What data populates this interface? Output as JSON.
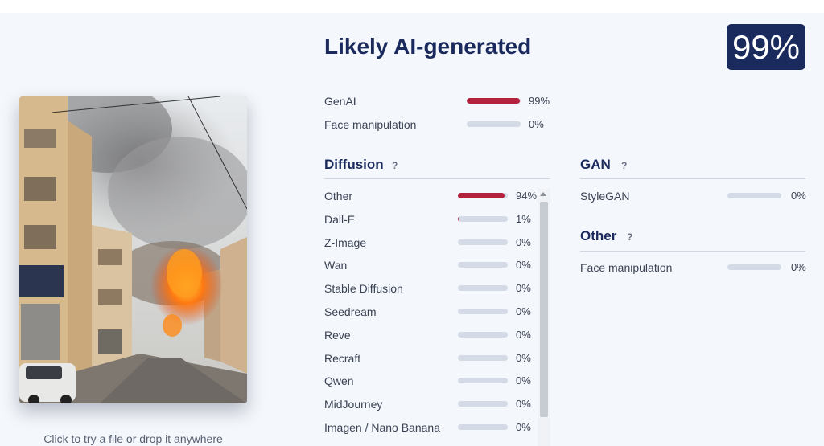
{
  "hint": "Click to try a file or drop it anywhere",
  "verdict": {
    "title": "Likely AI-generated",
    "score": "99%"
  },
  "summary": [
    {
      "label": "GenAI",
      "percent": "99%",
      "value": 0.99
    },
    {
      "label": "Face manipulation",
      "percent": "0%",
      "value": 0
    }
  ],
  "diffusion": {
    "title": "Diffusion",
    "help": "?",
    "items": [
      {
        "label": "Other",
        "percent": "94%",
        "value": 0.94
      },
      {
        "label": "Dall-E",
        "percent": "1%",
        "value": 0.01
      },
      {
        "label": "Z-Image",
        "percent": "0%",
        "value": 0
      },
      {
        "label": "Wan",
        "percent": "0%",
        "value": 0
      },
      {
        "label": "Stable Diffusion",
        "percent": "0%",
        "value": 0
      },
      {
        "label": "Seedream",
        "percent": "0%",
        "value": 0
      },
      {
        "label": "Reve",
        "percent": "0%",
        "value": 0
      },
      {
        "label": "Recraft",
        "percent": "0%",
        "value": 0
      },
      {
        "label": "Qwen",
        "percent": "0%",
        "value": 0
      },
      {
        "label": "MidJourney",
        "percent": "0%",
        "value": 0
      },
      {
        "label": "Imagen / Nano Banana",
        "percent": "0%",
        "value": 0
      }
    ]
  },
  "gan": {
    "title": "GAN",
    "help": "?",
    "items": [
      {
        "label": "StyleGAN",
        "percent": "0%",
        "value": 0
      }
    ]
  },
  "other": {
    "title": "Other",
    "help": "?",
    "items": [
      {
        "label": "Face manipulation",
        "percent": "0%",
        "value": 0
      }
    ]
  },
  "colors": {
    "accent": "#b3213d",
    "brand": "#1b2a5c",
    "track": "#d4dbe7"
  }
}
